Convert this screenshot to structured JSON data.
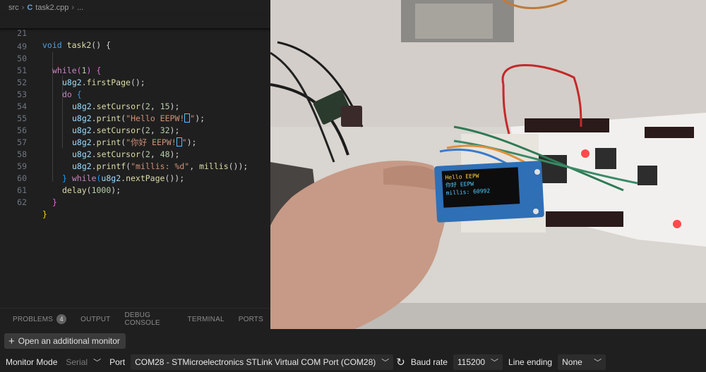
{
  "breadcrumb": {
    "folder": "src",
    "file_icon": "C",
    "file": "task2.cpp",
    "more": "..."
  },
  "sticky": {
    "line": "21",
    "text_kw": "void",
    "text_fn": "task2",
    "text_rest": "() {"
  },
  "code_lines": [
    "49",
    "50",
    "51",
    "52",
    "53",
    "54",
    "55",
    "56",
    "57",
    "58",
    "59",
    "60",
    "61",
    "62"
  ],
  "code": {
    "l50_kw": "while",
    "l50_rest_a": "(",
    "l50_num": "1",
    "l50_rest_b": ") {",
    "l51_var": "u8g2",
    "l51_fn": "firstPage",
    "l51_tail": "();",
    "l52_kw": "do",
    "l52_tail": " {",
    "l53_var": "u8g2",
    "l53_fn": "setCursor",
    "l53_a": "2",
    "l53_b": "15",
    "l53_tail": ");",
    "l54_var": "u8g2",
    "l54_fn": "print",
    "l54_str": "\"Hello EEPW!",
    "l54_strend": "\"",
    "l54_tail": ");",
    "l55_var": "u8g2",
    "l55_fn": "setCursor",
    "l55_a": "2",
    "l55_b": "32",
    "l55_tail": ");",
    "l56_var": "u8g2",
    "l56_fn": "print",
    "l56_str": "\"你好 EEPW!",
    "l56_strend": "\"",
    "l56_tail": ");",
    "l57_var": "u8g2",
    "l57_fn": "setCursor",
    "l57_a": "2",
    "l57_b": "48",
    "l57_tail": ");",
    "l58_var": "u8g2",
    "l58_fn": "printf",
    "l58_str": "\"millis: %d\"",
    "l58_mid": ", ",
    "l58_fn2": "millis",
    "l58_tail": "());",
    "l59_a": "} ",
    "l59_kw": "while",
    "l59_b": "(",
    "l59_var": "u8g2",
    "l59_fn": "nextPage",
    "l59_tail": "());",
    "l60_fn": "delay",
    "l60_num": "1000",
    "l60_tail": ");",
    "l61": "}",
    "l62": "}"
  },
  "panel_tabs": {
    "problems": "PROBLEMS",
    "problems_count": "4",
    "output": "OUTPUT",
    "debug": "DEBUG CONSOLE",
    "terminal": "TERMINAL",
    "ports": "PORTS"
  },
  "oled": {
    "line1": "Hello EEPW",
    "line2": "你好 EEPW",
    "line3": "millis: 60992"
  },
  "add_monitor": {
    "label": "Open an additional monitor"
  },
  "monitor_bar": {
    "mode_label": "Monitor Mode",
    "mode_value": "Serial",
    "port_label": "Port",
    "port_value": "COM28 - STMicroelectronics STLink Virtual COM Port (COM28)",
    "baud_label": "Baud rate",
    "baud_value": "115200",
    "ending_label": "Line ending",
    "ending_value": "None"
  },
  "colors": {
    "bg": "#1f1f1f",
    "keyword": "#c586c0",
    "function": "#dcdcaa",
    "string": "#ce9178",
    "number": "#b5cea8",
    "variable": "#9cdcfe",
    "oled_yellow": "#ffd23a",
    "oled_blue": "#4fc8ff"
  }
}
